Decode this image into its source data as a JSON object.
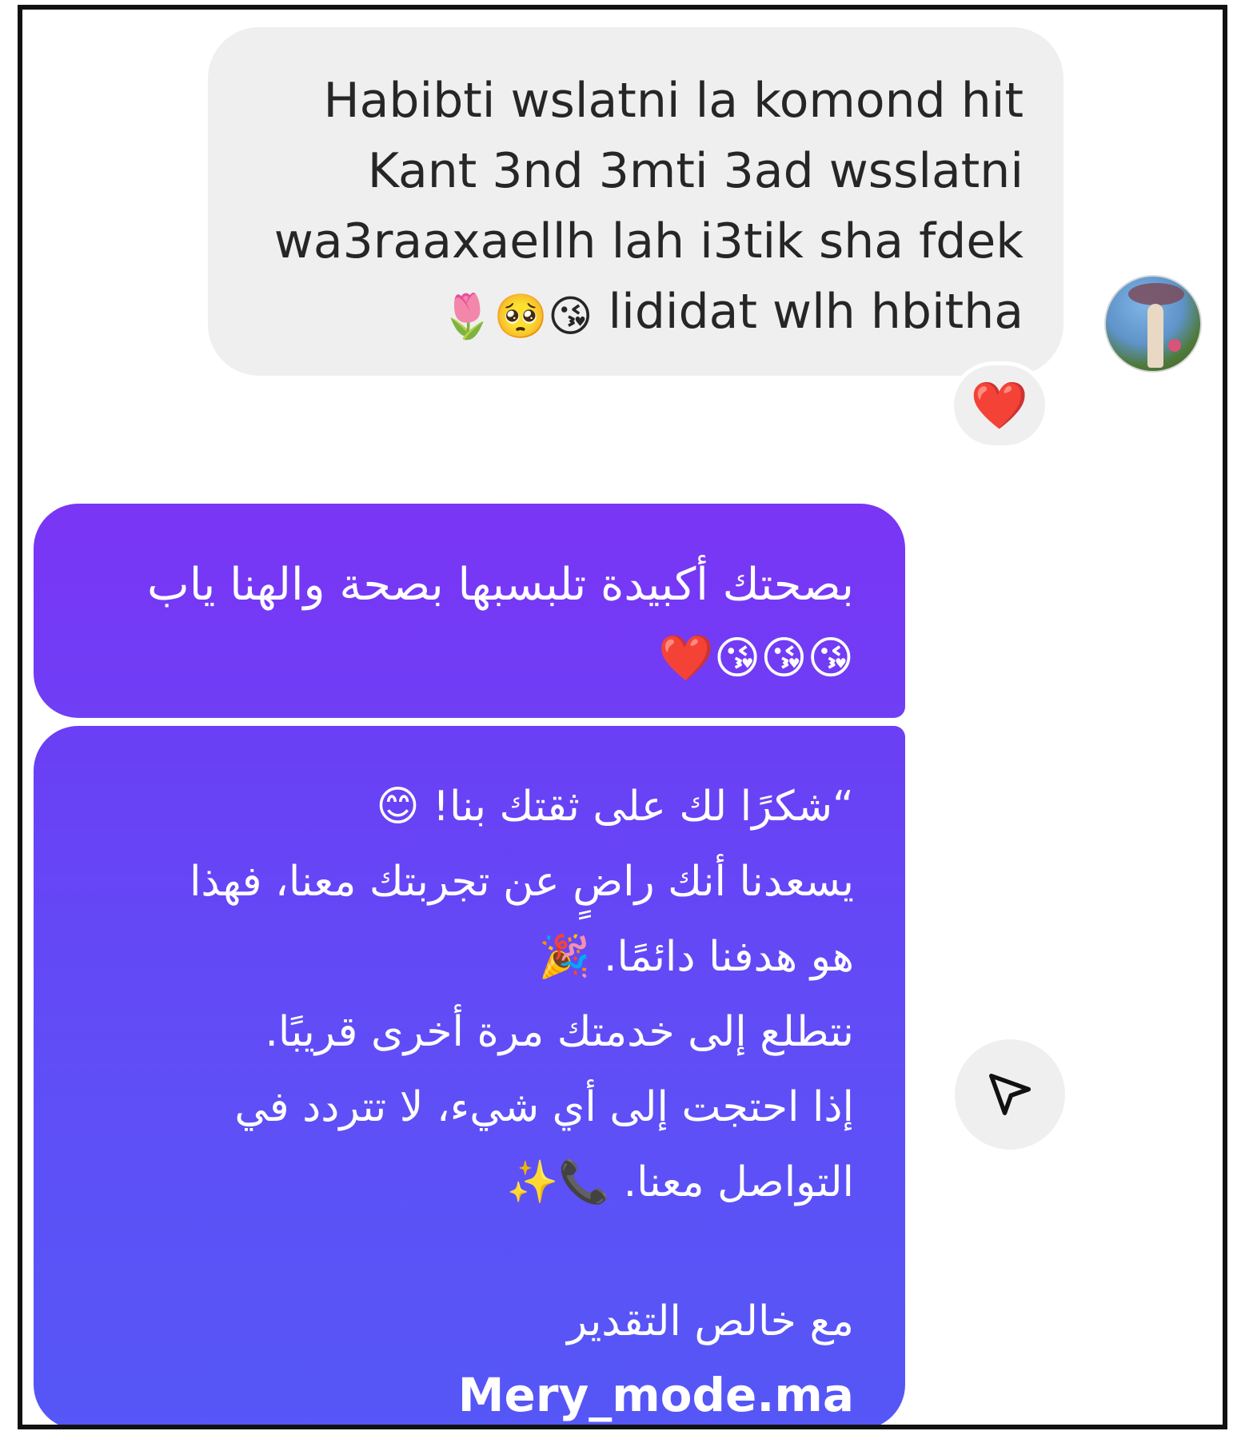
{
  "incoming_message": {
    "lines": [
      "Habibti wslatni la komond hit",
      "Kant 3nd 3mti 3ad wsslatni",
      "wa3raaxaellh lah i3tik sha fdek"
    ],
    "last_line_text": "lididat wlh hbitha",
    "last_line_emojis": "🌷🥺😘",
    "reaction": "❤️"
  },
  "outgoing_message_1": {
    "line1": "بصحتك أكبيدة تلبسبها بصحة والهنا ياب",
    "line2": "😘😘😘❤️"
  },
  "outgoing_message_2": {
    "lines": [
      "“شكرًا لك على ثقتك بنا! 😊",
      "يسعدنا أنك راضٍ عن تجربتك معنا، فهذا",
      "هو هدفنا دائمًا. 🎉",
      "نتطلع إلى خدمتك مرة أخرى قريبًا.",
      "إذا احتجت إلى أي شيء، لا تتردد في",
      "التواصل معنا. 📞✨"
    ],
    "closing": "مع خالص التقدير",
    "signature": "Mery_mode.ma"
  },
  "icons": {
    "avatar": "profile-photo",
    "share": "paper-plane-icon"
  },
  "colors": {
    "incoming_bubble": "#efefef",
    "outgoing_gradient_top": "#7a2ff4",
    "outgoing_gradient_bottom": "#5557f6",
    "reaction_heart": "#e0102a"
  }
}
